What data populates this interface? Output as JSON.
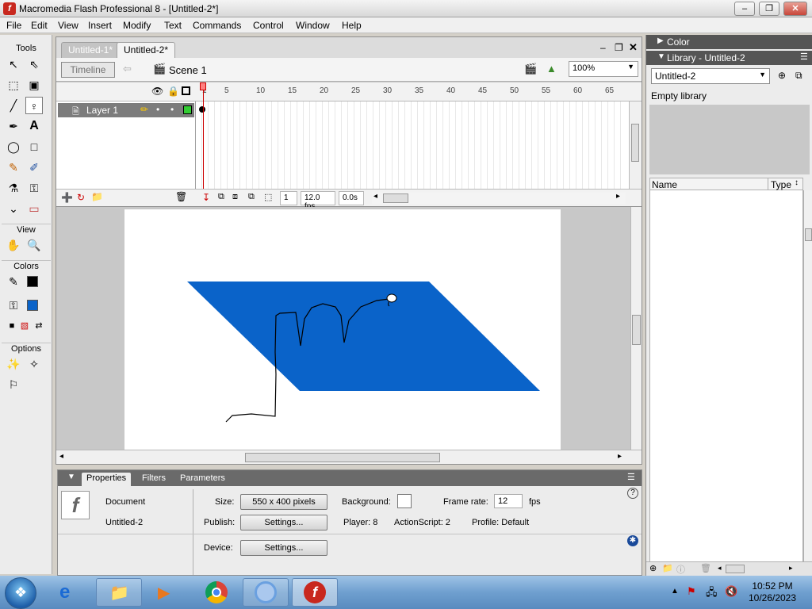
{
  "window": {
    "title": "Macromedia Flash Professional 8 - [Untitled-2*]"
  },
  "menu": [
    "File",
    "Edit",
    "View",
    "Insert",
    "Modify",
    "Text",
    "Commands",
    "Control",
    "Window",
    "Help"
  ],
  "tools": {
    "title": "Tools",
    "view_label": "View",
    "colors_label": "Colors",
    "options_label": "Options",
    "stroke_color": "#000000",
    "fill_color": "#0a63c9"
  },
  "document": {
    "tabs": [
      "Untitled-1*",
      "Untitled-2*"
    ],
    "timeline_button": "Timeline",
    "scene": "Scene 1",
    "zoom": "100%"
  },
  "timeline": {
    "ruler": [
      "1",
      "5",
      "10",
      "15",
      "20",
      "25",
      "30",
      "35",
      "40",
      "45",
      "50",
      "55",
      "60",
      "65"
    ],
    "layer_name": "Layer 1",
    "current_frame": "1",
    "fps": "12.0 fps",
    "elapsed": "0.0s"
  },
  "stage": {
    "shape_color": "#0a63c9",
    "background": "#ffffff"
  },
  "properties": {
    "tabs": [
      "Properties",
      "Filters",
      "Parameters"
    ],
    "type": "Document",
    "name": "Untitled-2",
    "size_label": "Size:",
    "size_value": "550 x 400 pixels",
    "background_label": "Background:",
    "frame_rate_label": "Frame rate:",
    "frame_rate_value": "12",
    "fps_unit": "fps",
    "publish_label": "Publish:",
    "settings_button": "Settings...",
    "player_label": "Player: 8",
    "actionscript_label": "ActionScript: 2",
    "profile_label": "Profile: Default",
    "device_label": "Device:",
    "device_button": "Settings..."
  },
  "right": {
    "color_panel": "Color",
    "library_panel": "Library - Untitled-2",
    "library_select": "Untitled-2",
    "empty_text": "Empty library",
    "col_name": "Name",
    "col_type": "Type"
  },
  "taskbar": {
    "time": "10:52 PM",
    "date": "10/26/2023"
  }
}
